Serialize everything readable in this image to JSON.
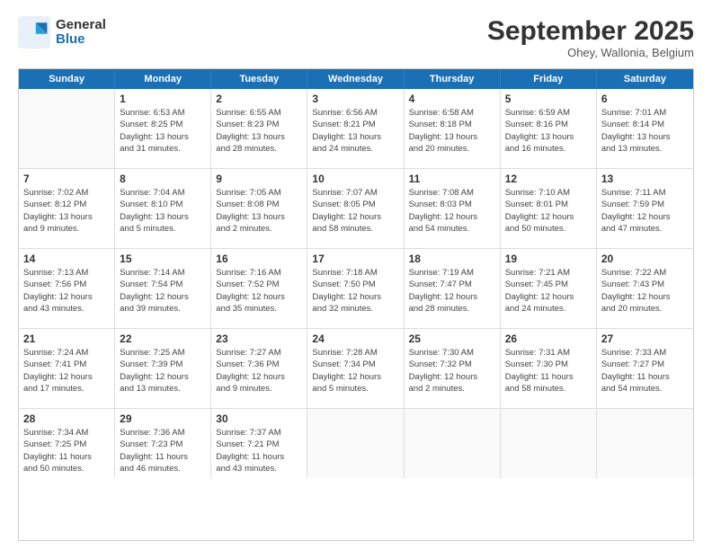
{
  "header": {
    "logo_general": "General",
    "logo_blue": "Blue",
    "month_title": "September 2025",
    "subtitle": "Ohey, Wallonia, Belgium"
  },
  "days_of_week": [
    "Sunday",
    "Monday",
    "Tuesday",
    "Wednesday",
    "Thursday",
    "Friday",
    "Saturday"
  ],
  "rows": [
    [
      {
        "day": "",
        "info": ""
      },
      {
        "day": "1",
        "info": "Sunrise: 6:53 AM\nSunset: 8:25 PM\nDaylight: 13 hours\nand 31 minutes."
      },
      {
        "day": "2",
        "info": "Sunrise: 6:55 AM\nSunset: 8:23 PM\nDaylight: 13 hours\nand 28 minutes."
      },
      {
        "day": "3",
        "info": "Sunrise: 6:56 AM\nSunset: 8:21 PM\nDaylight: 13 hours\nand 24 minutes."
      },
      {
        "day": "4",
        "info": "Sunrise: 6:58 AM\nSunset: 8:18 PM\nDaylight: 13 hours\nand 20 minutes."
      },
      {
        "day": "5",
        "info": "Sunrise: 6:59 AM\nSunset: 8:16 PM\nDaylight: 13 hours\nand 16 minutes."
      },
      {
        "day": "6",
        "info": "Sunrise: 7:01 AM\nSunset: 8:14 PM\nDaylight: 13 hours\nand 13 minutes."
      }
    ],
    [
      {
        "day": "7",
        "info": "Sunrise: 7:02 AM\nSunset: 8:12 PM\nDaylight: 13 hours\nand 9 minutes."
      },
      {
        "day": "8",
        "info": "Sunrise: 7:04 AM\nSunset: 8:10 PM\nDaylight: 13 hours\nand 5 minutes."
      },
      {
        "day": "9",
        "info": "Sunrise: 7:05 AM\nSunset: 8:08 PM\nDaylight: 13 hours\nand 2 minutes."
      },
      {
        "day": "10",
        "info": "Sunrise: 7:07 AM\nSunset: 8:05 PM\nDaylight: 12 hours\nand 58 minutes."
      },
      {
        "day": "11",
        "info": "Sunrise: 7:08 AM\nSunset: 8:03 PM\nDaylight: 12 hours\nand 54 minutes."
      },
      {
        "day": "12",
        "info": "Sunrise: 7:10 AM\nSunset: 8:01 PM\nDaylight: 12 hours\nand 50 minutes."
      },
      {
        "day": "13",
        "info": "Sunrise: 7:11 AM\nSunset: 7:59 PM\nDaylight: 12 hours\nand 47 minutes."
      }
    ],
    [
      {
        "day": "14",
        "info": "Sunrise: 7:13 AM\nSunset: 7:56 PM\nDaylight: 12 hours\nand 43 minutes."
      },
      {
        "day": "15",
        "info": "Sunrise: 7:14 AM\nSunset: 7:54 PM\nDaylight: 12 hours\nand 39 minutes."
      },
      {
        "day": "16",
        "info": "Sunrise: 7:16 AM\nSunset: 7:52 PM\nDaylight: 12 hours\nand 35 minutes."
      },
      {
        "day": "17",
        "info": "Sunrise: 7:18 AM\nSunset: 7:50 PM\nDaylight: 12 hours\nand 32 minutes."
      },
      {
        "day": "18",
        "info": "Sunrise: 7:19 AM\nSunset: 7:47 PM\nDaylight: 12 hours\nand 28 minutes."
      },
      {
        "day": "19",
        "info": "Sunrise: 7:21 AM\nSunset: 7:45 PM\nDaylight: 12 hours\nand 24 minutes."
      },
      {
        "day": "20",
        "info": "Sunrise: 7:22 AM\nSunset: 7:43 PM\nDaylight: 12 hours\nand 20 minutes."
      }
    ],
    [
      {
        "day": "21",
        "info": "Sunrise: 7:24 AM\nSunset: 7:41 PM\nDaylight: 12 hours\nand 17 minutes."
      },
      {
        "day": "22",
        "info": "Sunrise: 7:25 AM\nSunset: 7:39 PM\nDaylight: 12 hours\nand 13 minutes."
      },
      {
        "day": "23",
        "info": "Sunrise: 7:27 AM\nSunset: 7:36 PM\nDaylight: 12 hours\nand 9 minutes."
      },
      {
        "day": "24",
        "info": "Sunrise: 7:28 AM\nSunset: 7:34 PM\nDaylight: 12 hours\nand 5 minutes."
      },
      {
        "day": "25",
        "info": "Sunrise: 7:30 AM\nSunset: 7:32 PM\nDaylight: 12 hours\nand 2 minutes."
      },
      {
        "day": "26",
        "info": "Sunrise: 7:31 AM\nSunset: 7:30 PM\nDaylight: 11 hours\nand 58 minutes."
      },
      {
        "day": "27",
        "info": "Sunrise: 7:33 AM\nSunset: 7:27 PM\nDaylight: 11 hours\nand 54 minutes."
      }
    ],
    [
      {
        "day": "28",
        "info": "Sunrise: 7:34 AM\nSunset: 7:25 PM\nDaylight: 11 hours\nand 50 minutes."
      },
      {
        "day": "29",
        "info": "Sunrise: 7:36 AM\nSunset: 7:23 PM\nDaylight: 11 hours\nand 46 minutes."
      },
      {
        "day": "30",
        "info": "Sunrise: 7:37 AM\nSunset: 7:21 PM\nDaylight: 11 hours\nand 43 minutes."
      },
      {
        "day": "",
        "info": ""
      },
      {
        "day": "",
        "info": ""
      },
      {
        "day": "",
        "info": ""
      },
      {
        "day": "",
        "info": ""
      }
    ]
  ]
}
